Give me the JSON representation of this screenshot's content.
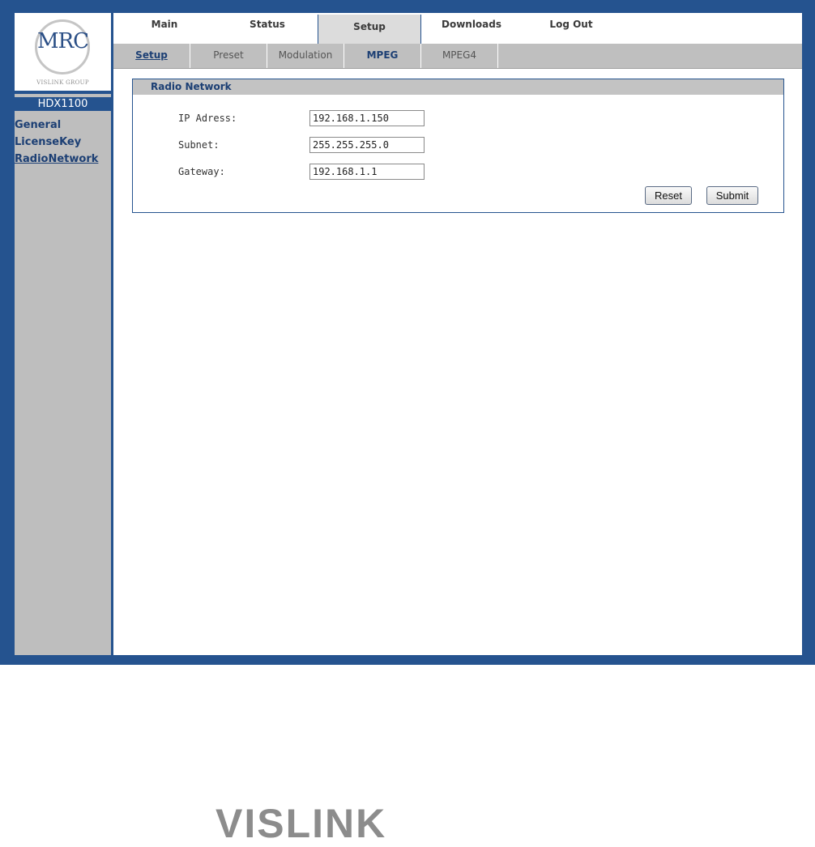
{
  "logo": {
    "text": "MRC",
    "sub": "VISLINK GROUP"
  },
  "device_name": "HDX1100",
  "sidebar": {
    "items": [
      {
        "label": "General"
      },
      {
        "label": "LicenseKey"
      },
      {
        "label": "RadioNetwork"
      }
    ]
  },
  "tabs": [
    {
      "label": "Main"
    },
    {
      "label": "Status"
    },
    {
      "label": "Setup"
    },
    {
      "label": "Downloads"
    },
    {
      "label": "Log Out"
    }
  ],
  "subtabs": [
    {
      "label": "Setup"
    },
    {
      "label": "Preset"
    },
    {
      "label": "Modulation"
    },
    {
      "label": "MPEG"
    },
    {
      "label": "MPEG4"
    }
  ],
  "panel": {
    "title": "Radio Network",
    "fields": {
      "ip": {
        "label": "IP Adress:",
        "value": "192.168.1.150"
      },
      "subnet": {
        "label": "Subnet:",
        "value": "255.255.255.0"
      },
      "gateway": {
        "label": "Gateway:",
        "value": "192.168.1.1"
      }
    },
    "reset_label": "Reset",
    "submit_label": "Submit"
  },
  "brand": "VISLINK",
  "colors": {
    "frame": "#25538f",
    "sidebar": "#bebebe",
    "link": "#1c3f74"
  }
}
